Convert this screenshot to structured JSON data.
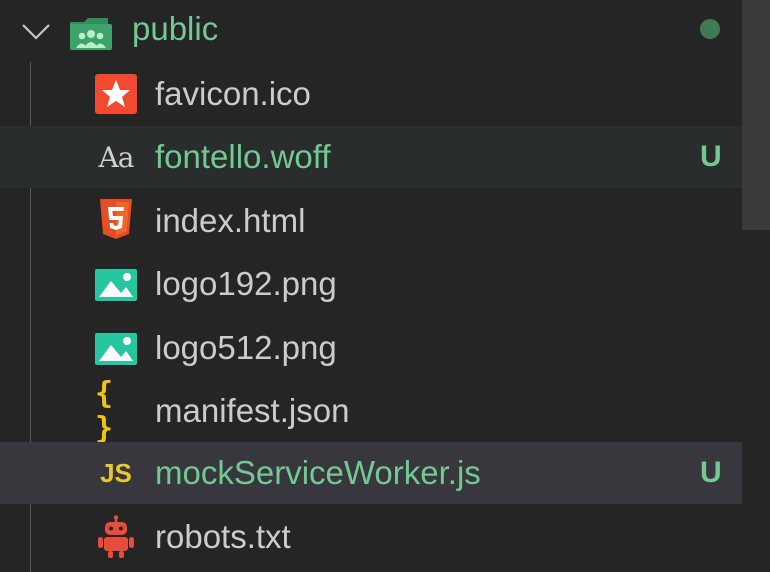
{
  "folder": {
    "name": "public",
    "expanded": true,
    "status_dot_color": "#3f7a53",
    "icon": "public-folder-icon",
    "chevron": "chevron-down-icon"
  },
  "files": [
    {
      "name": "favicon.ico",
      "icon": "favicon-star-icon",
      "status": ""
    },
    {
      "name": "fontello.woff",
      "icon": "font-icon",
      "status": "U"
    },
    {
      "name": "index.html",
      "icon": "html5-icon",
      "status": ""
    },
    {
      "name": "logo192.png",
      "icon": "image-icon",
      "status": ""
    },
    {
      "name": "logo512.png",
      "icon": "image-icon",
      "status": ""
    },
    {
      "name": "manifest.json",
      "icon": "json-braces-icon",
      "status": ""
    },
    {
      "name": "mockServiceWorker.js",
      "icon": "javascript-icon",
      "status": "U"
    },
    {
      "name": "robots.txt",
      "icon": "robot-icon",
      "status": ""
    }
  ],
  "colors": {
    "background": "#252526",
    "untracked_text": "#73c991",
    "default_text": "#cccccc",
    "selected_row": "#37373d",
    "hover_row": "#2a2d2e"
  }
}
